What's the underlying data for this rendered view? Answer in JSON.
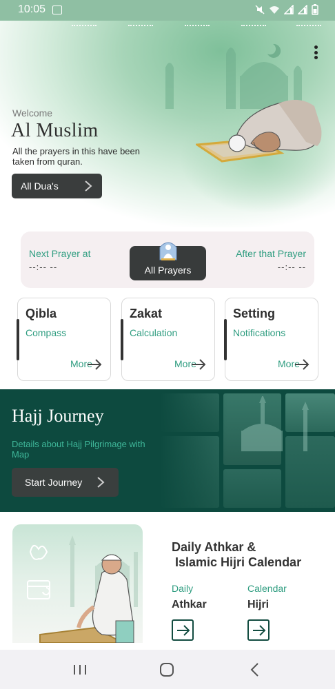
{
  "status_bar": {
    "time": "10:05",
    "icons": [
      "gallery-icon",
      "mute-icon",
      "wifi-icon",
      "signal-icon",
      "signal-icon",
      "battery-icon"
    ]
  },
  "hero": {
    "welcome": "Welcome",
    "title": "Al Muslim",
    "description": "All the prayers in this have been taken from quran.",
    "button_label": "All Dua's"
  },
  "prayer_card": {
    "next_label": "Next Prayer at",
    "next_value": "--:-- --",
    "center_button": "All Prayers",
    "after_label": "After that Prayer",
    "after_value": "--:-- --"
  },
  "features": [
    {
      "title": "Qibla",
      "subtitle": "Compass",
      "more": "More"
    },
    {
      "title": "Zakat",
      "subtitle": "Calculation",
      "more": "More"
    },
    {
      "title": "Setting",
      "subtitle": "Notifications",
      "more": "More"
    }
  ],
  "hajj": {
    "title": "Hajj Journey",
    "description": "Details about Hajj Pilgrimage with Map",
    "button_label": "Start Journey"
  },
  "athkar": {
    "title": "Daily Athkar &\n Islamic Hijri Calendar",
    "items": [
      {
        "label": "Daily",
        "value": "Athkar"
      },
      {
        "label": "Calendar",
        "value": "Hijri"
      }
    ]
  },
  "colors": {
    "accent_green": "#2f9d80",
    "dark_green": "#0d4a3f",
    "dark_button": "#3a3d3d"
  }
}
